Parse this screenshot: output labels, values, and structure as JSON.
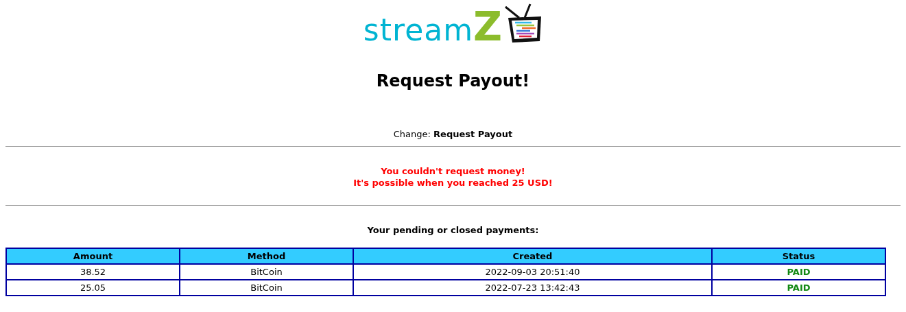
{
  "logo": {
    "text": "stream",
    "accent": "Z"
  },
  "title": "Request Payout!",
  "change": {
    "label": "Change:",
    "link": "Request Payout"
  },
  "error": [
    "You couldn't request money!",
    "It's possible when you reached 25 USD!"
  ],
  "payments_heading": "Your pending or closed payments:",
  "table": {
    "columns": [
      "Amount",
      "Method",
      "Created",
      "Status"
    ],
    "rows": [
      {
        "amount": "38.52",
        "method": "BitCoin",
        "created": "2022-09-03 20:51:40",
        "status": "PAID"
      },
      {
        "amount": "25.05",
        "method": "BitCoin",
        "created": "2022-07-23 13:42:43",
        "status": "PAID"
      }
    ]
  }
}
